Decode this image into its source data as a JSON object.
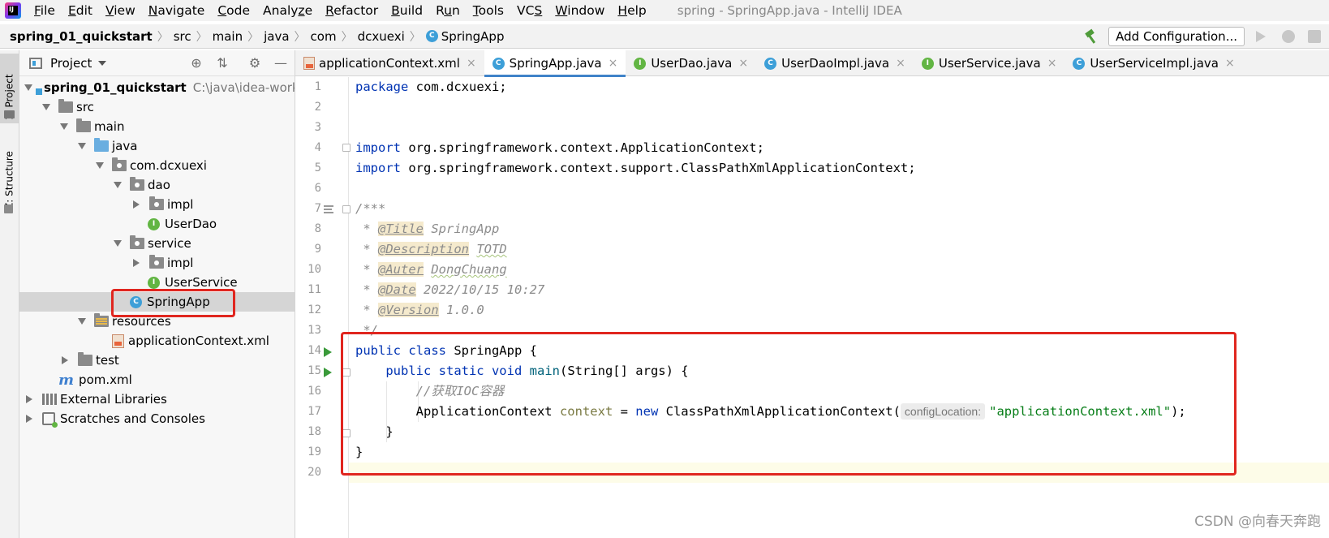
{
  "menu": {
    "items": [
      "File",
      "Edit",
      "View",
      "Navigate",
      "Code",
      "Analyze",
      "Refactor",
      "Build",
      "Run",
      "Tools",
      "VCS",
      "Window",
      "Help"
    ],
    "mnemonics": [
      "F",
      "E",
      "V",
      "N",
      "C",
      "z",
      "R",
      "B",
      "u",
      "T",
      "S",
      "W",
      "H"
    ],
    "window_title": "spring - SpringApp.java - IntelliJ IDEA"
  },
  "navbar": {
    "crumbs": [
      "spring_01_quickstart",
      "src",
      "main",
      "java",
      "com",
      "dcxuexi",
      "SpringApp"
    ],
    "add_configuration": "Add Configuration..."
  },
  "stripe": {
    "project": "1: Project",
    "structure": "Z: Structure"
  },
  "project_panel": {
    "title": "Project",
    "tree": [
      {
        "label": "spring_01_quickstart",
        "hint": "C:\\java\\idea-worksp",
        "depth": 0,
        "arrow": "down",
        "icon": "module",
        "bold": true
      },
      {
        "label": "src",
        "depth": 1,
        "arrow": "down",
        "icon": "folder"
      },
      {
        "label": "main",
        "depth": 2,
        "arrow": "down",
        "icon": "folder"
      },
      {
        "label": "java",
        "depth": 3,
        "arrow": "down",
        "icon": "folder-blue"
      },
      {
        "label": "com.dcxuexi",
        "depth": 4,
        "arrow": "down",
        "icon": "package"
      },
      {
        "label": "dao",
        "depth": 5,
        "arrow": "down",
        "icon": "package"
      },
      {
        "label": "impl",
        "depth": 6,
        "arrow": "right",
        "icon": "package"
      },
      {
        "label": "UserDao",
        "depth": 6,
        "arrow": "none",
        "icon": "interface"
      },
      {
        "label": "service",
        "depth": 5,
        "arrow": "down",
        "icon": "package"
      },
      {
        "label": "impl",
        "depth": 6,
        "arrow": "right",
        "icon": "package"
      },
      {
        "label": "UserService",
        "depth": 6,
        "arrow": "none",
        "icon": "interface"
      },
      {
        "label": "SpringApp",
        "depth": 5,
        "arrow": "none",
        "icon": "class",
        "selected": true
      },
      {
        "label": "resources",
        "depth": 3,
        "arrow": "down",
        "icon": "resources"
      },
      {
        "label": "applicationContext.xml",
        "depth": 4,
        "arrow": "none",
        "icon": "xml"
      },
      {
        "label": "test",
        "depth": 2,
        "arrow": "right",
        "icon": "folder"
      },
      {
        "label": "pom.xml",
        "depth": 1,
        "arrow": "none",
        "icon": "maven"
      },
      {
        "label": "External Libraries",
        "depth": 0,
        "arrow": "right",
        "icon": "library"
      },
      {
        "label": "Scratches and Consoles",
        "depth": 0,
        "arrow": "right",
        "icon": "scratch"
      }
    ]
  },
  "tabs": [
    {
      "label": "applicationContext.xml",
      "icon": "xml",
      "close": "×"
    },
    {
      "label": "SpringApp.java",
      "icon": "class",
      "close": "×",
      "active": true
    },
    {
      "label": "UserDao.java",
      "icon": "interface",
      "close": "×"
    },
    {
      "label": "UserDaoImpl.java",
      "icon": "class",
      "close": "×"
    },
    {
      "label": "UserService.java",
      "icon": "interface",
      "close": "×"
    },
    {
      "label": "UserServiceImpl.java",
      "icon": "class",
      "close": "×"
    }
  ],
  "editor": {
    "line_numbers": [
      "1",
      "2",
      "3",
      "4",
      "5",
      "6",
      "7",
      "8",
      "9",
      "10",
      "11",
      "12",
      "13",
      "14",
      "15",
      "16",
      "17",
      "18",
      "19",
      "20"
    ],
    "code": {
      "l1_kw": "package",
      "l1_rest": " com.dcxuexi;",
      "l4_kw": "import",
      "l4_rest": " org.springframework.context.ApplicationContext;",
      "l5_kw": "import",
      "l5_rest": " org.springframework.context.support.ClassPathXmlApplicationContext;",
      "l7": "/***",
      "doc_prefix": " * ",
      "l8_tag": "@Title",
      "l8_val": " SpringApp",
      "l9_tag": "@Description",
      "l9_val": "TOTD",
      "l10_tag": "@Auter",
      "l10_val": "DongChuang",
      "l11_tag": "@Date",
      "l11_val": " 2022/10/15 10:27",
      "l12_tag": "@Version",
      "l12_val": " 1.0.0",
      "l13": " */",
      "l14_kw": "public class",
      "l14_rest": " SpringApp {",
      "l15_kw": "public static void",
      "l15_fn": "main",
      "l15_rest": "(String[] args) {",
      "l16": "//获取IOC容器",
      "l17_type": "ApplicationContext ",
      "l17_var": "context",
      "l17_eq": " = ",
      "l17_kw": "new",
      "l17_cls": " ClassPathXmlApplicationContext(",
      "l17_hint": "configLocation:",
      "l17_str": "\"applicationContext.xml\"",
      "l17_end": ");",
      "l18": "}",
      "l19": "}"
    }
  },
  "watermark": "CSDN @向春天奔跑",
  "colors": {
    "highlight_box": "#e0261f",
    "keyword": "#0033b3",
    "string": "#067d17",
    "comment": "#8c8c8c",
    "active_tab_underline": "#4083c9"
  }
}
